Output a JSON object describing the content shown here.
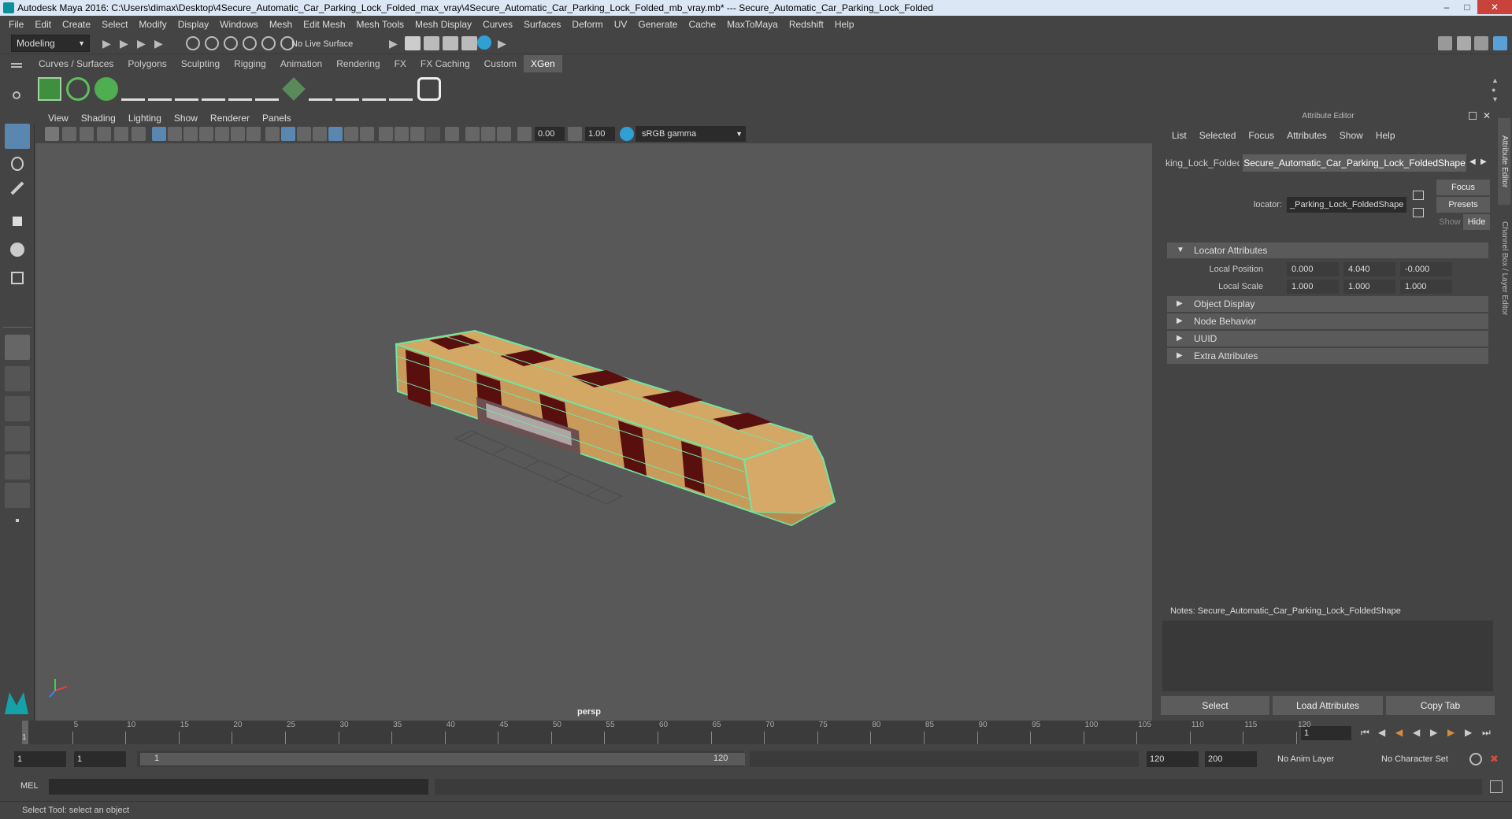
{
  "window": {
    "title": "Autodesk Maya 2016: C:\\Users\\dimax\\Desktop\\4Secure_Automatic_Car_Parking_Lock_Folded_max_vray\\4Secure_Automatic_Car_Parking_Lock_Folded_mb_vray.mb*   ---   Secure_Automatic_Car_Parking_Lock_Folded"
  },
  "menubar": [
    "File",
    "Edit",
    "Create",
    "Select",
    "Modify",
    "Display",
    "Windows",
    "Mesh",
    "Edit Mesh",
    "Mesh Tools",
    "Mesh Display",
    "Curves",
    "Surfaces",
    "Deform",
    "UV",
    "Generate",
    "Cache",
    "MaxToMaya",
    "Redshift",
    "Help"
  ],
  "statusline": {
    "mode": "Modeling",
    "live_surface": "No Live Surface"
  },
  "shelf": {
    "tabs": [
      "Curves / Surfaces",
      "Polygons",
      "Sculpting",
      "Rigging",
      "Animation",
      "Rendering",
      "FX",
      "FX Caching",
      "Custom",
      "XGen"
    ],
    "active_tab": "XGen"
  },
  "viewport": {
    "menu": [
      "View",
      "Shading",
      "Lighting",
      "Show",
      "Renderer",
      "Panels"
    ],
    "exposure": "0.00",
    "gamma": "1.00",
    "color_space": "sRGB gamma",
    "camera_label": "persp"
  },
  "attribute_editor": {
    "header": "Attribute Editor",
    "menu": [
      "List",
      "Selected",
      "Focus",
      "Attributes",
      "Show",
      "Help"
    ],
    "tab_left": "king_Lock_Folded",
    "tab_active": "Secure_Automatic_Car_Parking_Lock_FoldedShape",
    "locator_label": "locator:",
    "locator_value": "_Parking_Lock_FoldedShape",
    "focus_btn": "Focus",
    "presets_btn": "Presets",
    "show_btn": "Show",
    "hide_btn": "Hide",
    "sections": {
      "locator": "Locator Attributes",
      "object_display": "Object Display",
      "node_behavior": "Node Behavior",
      "uuid": "UUID",
      "extra": "Extra Attributes"
    },
    "local_position": {
      "label": "Local Position",
      "x": "0.000",
      "y": "4.040",
      "z": "-0.000"
    },
    "local_scale": {
      "label": "Local Scale",
      "x": "1.000",
      "y": "1.000",
      "z": "1.000"
    },
    "notes": "Notes:  Secure_Automatic_Car_Parking_Lock_FoldedShape",
    "buttons": {
      "select": "Select",
      "load": "Load Attributes",
      "copy": "Copy Tab"
    }
  },
  "side_tabs": {
    "attribute_editor": "Attribute Editor",
    "channel_box": "Channel Box / Layer Editor"
  },
  "timeline": {
    "ticks": [
      "5",
      "10",
      "15",
      "20",
      "25",
      "30",
      "35",
      "40",
      "45",
      "50",
      "55",
      "60",
      "65",
      "70",
      "75",
      "80",
      "85",
      "90",
      "95",
      "100",
      "105",
      "110",
      "115",
      "120"
    ],
    "current_frame_marker": "1",
    "current_frame": "1"
  },
  "range": {
    "start": "1",
    "anim_start": "1",
    "slider_start": "1",
    "slider_end": "120",
    "end": "120",
    "anim_end": "200",
    "anim_layer": "No Anim Layer",
    "character_set": "No Character Set"
  },
  "cmdline": {
    "label": "MEL"
  },
  "helpline": {
    "text": "Select Tool: select an object"
  }
}
